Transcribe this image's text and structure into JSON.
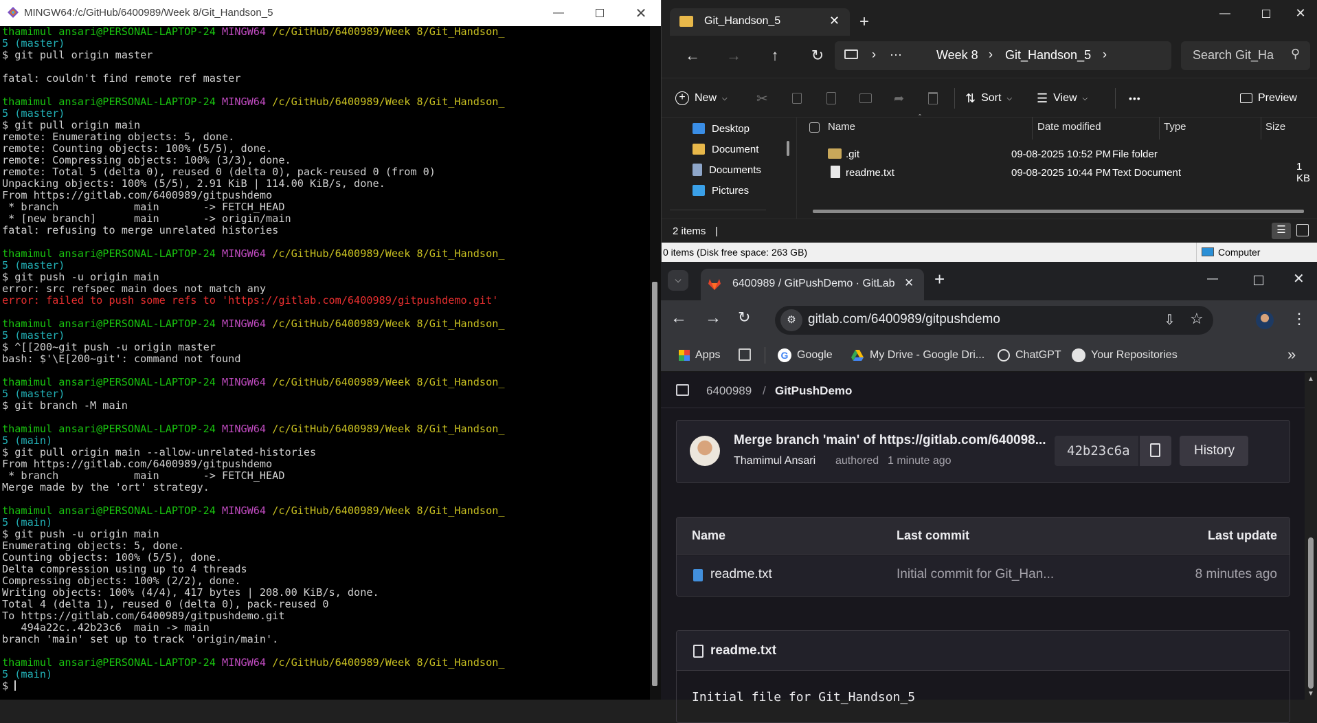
{
  "terminal": {
    "title": "MINGW64:/c/GitHub/6400989/Week 8/Git_Handson_5",
    "lines": [
      [
        {
          "t": "thamimul ansari@PERSONAL-LAPTOP-24 ",
          "c": "grn"
        },
        {
          "t": "MINGW64 ",
          "c": "mag"
        },
        {
          "t": "/c/GitHub/6400989/Week 8/Git_Handson_",
          "c": "yel"
        }
      ],
      [
        {
          "t": "5 (master)",
          "c": "cyn"
        }
      ],
      [
        {
          "t": "$ git pull origin master",
          "c": ""
        }
      ],
      [
        {
          "t": "",
          "c": ""
        }
      ],
      [
        {
          "t": "fatal: couldn't find remote ref master",
          "c": ""
        }
      ],
      [
        {
          "t": "",
          "c": ""
        }
      ],
      [
        {
          "t": "thamimul ansari@PERSONAL-LAPTOP-24 ",
          "c": "grn"
        },
        {
          "t": "MINGW64 ",
          "c": "mag"
        },
        {
          "t": "/c/GitHub/6400989/Week 8/Git_Handson_",
          "c": "yel"
        }
      ],
      [
        {
          "t": "5 (master)",
          "c": "cyn"
        }
      ],
      [
        {
          "t": "$ git pull origin main",
          "c": ""
        }
      ],
      [
        {
          "t": "remote: Enumerating objects: 5, done.",
          "c": ""
        }
      ],
      [
        {
          "t": "remote: Counting objects: 100% (5/5), done.",
          "c": ""
        }
      ],
      [
        {
          "t": "remote: Compressing objects: 100% (3/3), done.",
          "c": ""
        }
      ],
      [
        {
          "t": "remote: Total 5 (delta 0), reused 0 (delta 0), pack-reused 0 (from 0)",
          "c": ""
        }
      ],
      [
        {
          "t": "Unpacking objects: 100% (5/5), 2.91 KiB | 114.00 KiB/s, done.",
          "c": ""
        }
      ],
      [
        {
          "t": "From https://gitlab.com/6400989/gitpushdemo",
          "c": ""
        }
      ],
      [
        {
          "t": " * branch            main       -> FETCH_HEAD",
          "c": ""
        }
      ],
      [
        {
          "t": " * [new branch]      main       -> origin/main",
          "c": ""
        }
      ],
      [
        {
          "t": "fatal: refusing to merge unrelated histories",
          "c": ""
        }
      ],
      [
        {
          "t": "",
          "c": ""
        }
      ],
      [
        {
          "t": "thamimul ansari@PERSONAL-LAPTOP-24 ",
          "c": "grn"
        },
        {
          "t": "MINGW64 ",
          "c": "mag"
        },
        {
          "t": "/c/GitHub/6400989/Week 8/Git_Handson_",
          "c": "yel"
        }
      ],
      [
        {
          "t": "5 (master)",
          "c": "cyn"
        }
      ],
      [
        {
          "t": "$ git push -u origin main",
          "c": ""
        }
      ],
      [
        {
          "t": "error: src refspec main does not match any",
          "c": ""
        }
      ],
      [
        {
          "t": "error: failed to push some refs to 'https://gitlab.com/6400989/gitpushdemo.git'",
          "c": "red"
        }
      ],
      [
        {
          "t": "",
          "c": ""
        }
      ],
      [
        {
          "t": "thamimul ansari@PERSONAL-LAPTOP-24 ",
          "c": "grn"
        },
        {
          "t": "MINGW64 ",
          "c": "mag"
        },
        {
          "t": "/c/GitHub/6400989/Week 8/Git_Handson_",
          "c": "yel"
        }
      ],
      [
        {
          "t": "5 (master)",
          "c": "cyn"
        }
      ],
      [
        {
          "t": "$ ^[[200~git push -u origin master",
          "c": ""
        }
      ],
      [
        {
          "t": "bash: $'\\E[200~git': command not found",
          "c": ""
        }
      ],
      [
        {
          "t": "",
          "c": ""
        }
      ],
      [
        {
          "t": "thamimul ansari@PERSONAL-LAPTOP-24 ",
          "c": "grn"
        },
        {
          "t": "MINGW64 ",
          "c": "mag"
        },
        {
          "t": "/c/GitHub/6400989/Week 8/Git_Handson_",
          "c": "yel"
        }
      ],
      [
        {
          "t": "5 (master)",
          "c": "cyn"
        }
      ],
      [
        {
          "t": "$ git branch -M main",
          "c": ""
        }
      ],
      [
        {
          "t": "",
          "c": ""
        }
      ],
      [
        {
          "t": "thamimul ansari@PERSONAL-LAPTOP-24 ",
          "c": "grn"
        },
        {
          "t": "MINGW64 ",
          "c": "mag"
        },
        {
          "t": "/c/GitHub/6400989/Week 8/Git_Handson_",
          "c": "yel"
        }
      ],
      [
        {
          "t": "5 (main)",
          "c": "cyn"
        }
      ],
      [
        {
          "t": "$ git pull origin main --allow-unrelated-histories",
          "c": ""
        }
      ],
      [
        {
          "t": "From https://gitlab.com/6400989/gitpushdemo",
          "c": ""
        }
      ],
      [
        {
          "t": " * branch            main       -> FETCH_HEAD",
          "c": ""
        }
      ],
      [
        {
          "t": "Merge made by the 'ort' strategy.",
          "c": ""
        }
      ],
      [
        {
          "t": "",
          "c": ""
        }
      ],
      [
        {
          "t": "thamimul ansari@PERSONAL-LAPTOP-24 ",
          "c": "grn"
        },
        {
          "t": "MINGW64 ",
          "c": "mag"
        },
        {
          "t": "/c/GitHub/6400989/Week 8/Git_Handson_",
          "c": "yel"
        }
      ],
      [
        {
          "t": "5 (main)",
          "c": "cyn"
        }
      ],
      [
        {
          "t": "$ git push -u origin main",
          "c": ""
        }
      ],
      [
        {
          "t": "Enumerating objects: 5, done.",
          "c": ""
        }
      ],
      [
        {
          "t": "Counting objects: 100% (5/5), done.",
          "c": ""
        }
      ],
      [
        {
          "t": "Delta compression using up to 4 threads",
          "c": ""
        }
      ],
      [
        {
          "t": "Compressing objects: 100% (2/2), done.",
          "c": ""
        }
      ],
      [
        {
          "t": "Writing objects: 100% (4/4), 417 bytes | 208.00 KiB/s, done.",
          "c": ""
        }
      ],
      [
        {
          "t": "Total 4 (delta 1), reused 0 (delta 0), pack-reused 0",
          "c": ""
        }
      ],
      [
        {
          "t": "To https://gitlab.com/6400989/gitpushdemo.git",
          "c": ""
        }
      ],
      [
        {
          "t": "   494a22c..42b23c6  main -> main",
          "c": ""
        }
      ],
      [
        {
          "t": "branch 'main' set up to track 'origin/main'.",
          "c": ""
        }
      ],
      [
        {
          "t": "",
          "c": ""
        }
      ],
      [
        {
          "t": "thamimul ansari@PERSONAL-LAPTOP-24 ",
          "c": "grn"
        },
        {
          "t": "MINGW64 ",
          "c": "mag"
        },
        {
          "t": "/c/GitHub/6400989/Week 8/Git_Handson_",
          "c": "yel"
        }
      ],
      [
        {
          "t": "5 (main)",
          "c": "cyn"
        }
      ],
      [
        {
          "t": "$ ",
          "c": ""
        }
      ]
    ]
  },
  "explorer": {
    "tab_title": "Git_Handson_5",
    "breadcrumb": [
      "Week 8",
      "Git_Handson_5"
    ],
    "breadcrumb_more": "···",
    "search_placeholder": "Search Git_Ha",
    "toolbar": {
      "new": "New",
      "sort": "Sort",
      "view": "View",
      "more": "•••",
      "preview": "Preview"
    },
    "nav": [
      {
        "label": "Desktop",
        "icon": "desktop-icon",
        "color": "#3a8ee6"
      },
      {
        "label": "Document",
        "icon": "folder-icon",
        "color": "#e8b84a"
      },
      {
        "label": "Documents",
        "icon": "documents-icon",
        "color": "#8ea6c9"
      },
      {
        "label": "Pictures",
        "icon": "pictures-icon",
        "color": "#3aa0e8"
      }
    ],
    "columns": {
      "name": "Name",
      "date": "Date modified",
      "type": "Type",
      "size": "Size"
    },
    "files": [
      {
        "name": ".git",
        "date": "09-08-2025 10:52 PM",
        "type": "File folder",
        "size": "",
        "icon": "folder-icon"
      },
      {
        "name": "readme.txt",
        "date": "09-08-2025 10:44 PM",
        "type": "Text Document",
        "size": "1 KB",
        "icon": "text-file-icon"
      }
    ],
    "status": "2 items",
    "status_bar": "0 items (Disk free space: 263 GB)",
    "status_right": "Computer"
  },
  "browser": {
    "tab_title": "6400989 / GitPushDemo · GitLab",
    "url": "gitlab.com/6400989/gitpushdemo",
    "bookmarks": [
      "Apps",
      "Google",
      "My Drive - Google Dri...",
      "ChatGPT",
      "Your Repositories"
    ],
    "gitlab": {
      "breadcrumb_group": "6400989",
      "breadcrumb_sep": "/",
      "breadcrumb_project": "GitPushDemo",
      "commit_title": "Merge branch 'main' of https://gitlab.com/640098...",
      "commit_author": "Thamimul Ansari",
      "commit_authored": "authored",
      "commit_time": "1 minute ago",
      "commit_sha": "42b23c6a",
      "history_label": "History",
      "table_headers": {
        "name": "Name",
        "last_commit": "Last commit",
        "last_update": "Last update"
      },
      "rows": [
        {
          "name": "readme.txt",
          "last_commit": "Initial commit for Git_Han...",
          "last_update": "8 minutes ago"
        }
      ],
      "readme_title": "readme.txt",
      "readme_content": "Initial file for Git_Handson_5"
    }
  },
  "colors": {
    "terminal_bg": "#000000",
    "prompt_user": "#19c40f",
    "prompt_mingw": "#c04bc0",
    "prompt_path": "#c8c021",
    "prompt_branch": "#22b0b6",
    "error": "#e82f2f",
    "explorer_bg": "#202020",
    "gitlab_bg": "#18171d"
  }
}
